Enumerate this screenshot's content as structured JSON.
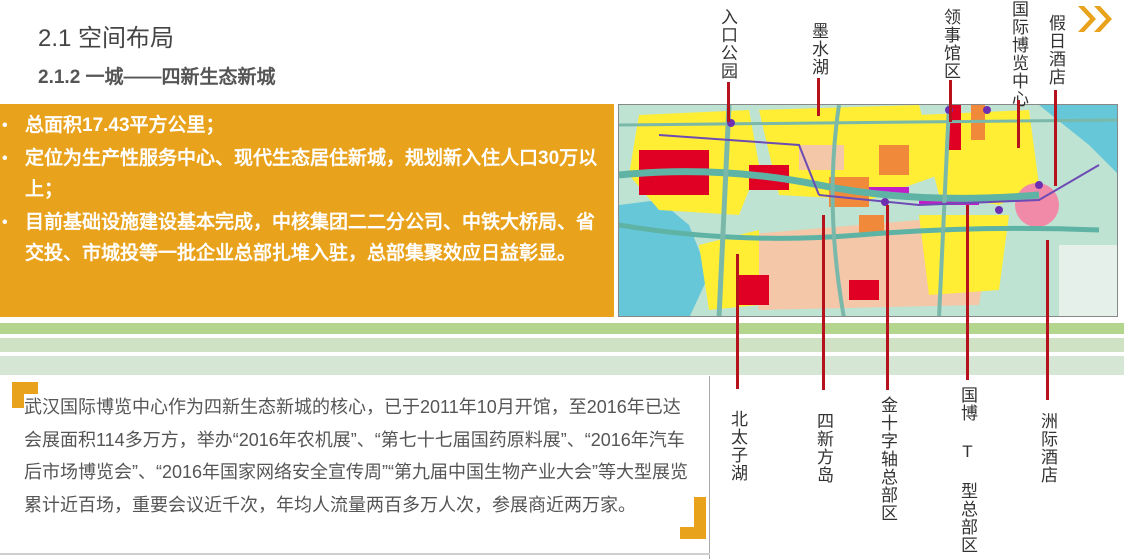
{
  "header": {
    "title": "2.1 空间布局",
    "subtitle": "2.1.2 一城——四新生态新城"
  },
  "bullets": [
    "总面积17.43平方公里；",
    "定位为生产性服务中心、现代生态居住新城，规划新入住人口30万以上；",
    "目前基础设施建设基本完成，中核集团二二分公司、中铁大桥局、省交投、市城投等一批企业总部扎堆入驻，总部集聚效应日益彰显。"
  ],
  "bullet_marker": "•",
  "body_text": "武汉国际博览中心作为四新生态新城的核心，已于2011年10月开馆，至2016年已达会展面积114多万方，举办“2016年农机展”、“第七十七届国药原料展”、“2016年汽车后市场博览会”、“2016年国家网络安全宣传周”“第九届中国生物产业大会”等大型展览累计近百场，重要会议近千次，年均人流量两百多万人次，参展商近两万家。",
  "map_labels_top": [
    "入口公园",
    "墨水湖",
    "领事馆区",
    "国际博览中心",
    "假日酒店"
  ],
  "map_labels_bottom": [
    "北太子湖",
    "四新方岛",
    "金十字轴总部区",
    "国博 T 型总部区",
    "洲际酒店"
  ],
  "colors": {
    "accent_orange": "#e9a21c",
    "pin_red": "#b5121b",
    "stripe_green": "#b4d58e"
  }
}
